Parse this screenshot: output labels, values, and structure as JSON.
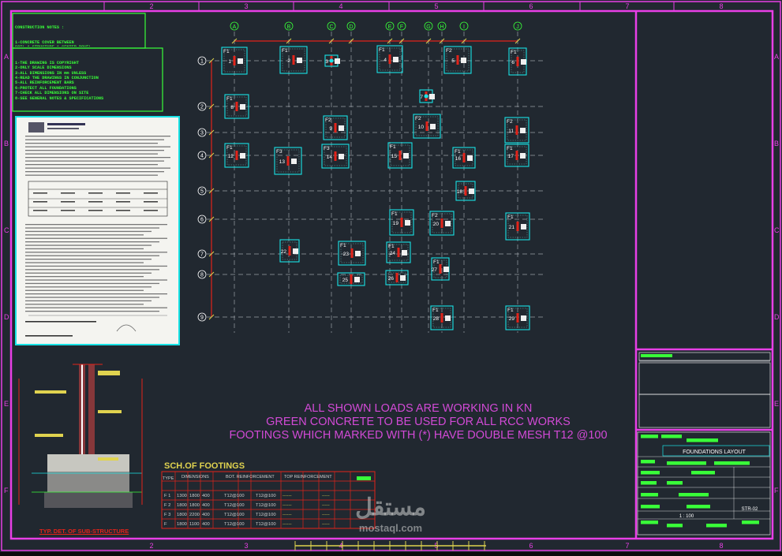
{
  "grid_columns": [
    "A",
    "B",
    "C",
    "D",
    "E",
    "F",
    "G",
    "H",
    "I",
    "J"
  ],
  "grid_rows": [
    "1",
    "2",
    "3",
    "4",
    "5",
    "6",
    "7",
    "8",
    "9"
  ],
  "border_ticks_top": [
    "2",
    "3",
    "4",
    "5",
    "6",
    "7",
    "8"
  ],
  "border_ticks_side": [
    "A",
    "B",
    "C",
    "D",
    "E",
    "F"
  ],
  "footing_tags": [
    "1",
    "2",
    "3",
    "4",
    "5",
    "6",
    "7",
    "8",
    "9",
    "10",
    "11",
    "12",
    "13",
    "14",
    "15",
    "16",
    "17",
    "18",
    "19",
    "20",
    "21",
    "22",
    "23",
    "24",
    "25",
    "26",
    "27",
    "28",
    "29"
  ],
  "footing_types": [
    "F1",
    "F2",
    "F3"
  ],
  "notes": {
    "title": "CONSTRUCTION NOTES :",
    "lines_a": [
      "1-CONCRETE COVER BETWEEN",
      "SOIL & STRUCTURE & CENTER DOWEL",
      "2-COMPACTED FILL FOUNDATION",
      "3-DESIGN WORK TO BE APPROVED",
      "4-REFER TO SOIL REPORT"
    ],
    "lines_b": [
      "1-THE DRAWING IS COPYRIGHT",
      "2-ONLY SCALE DIMENSIONS",
      "3-ALL DIMENSIONS IN mm UNLESS",
      "4-READ THE DRAWINGS IN CONJUNCTION",
      "5-ALL REINFORCEMENT BARS",
      "6-PROTECT ALL FOUNDATIONS",
      "7-CHECK ALL DIMENSIONS ON SITE",
      "8-SEE GENERAL NOTES & SPECIFICATIONS"
    ]
  },
  "load_notes": [
    "ALL SHOWN LOADS ARE WORKING IN KN",
    "GREEN CONCRETE TO BE USED FOR ALL RCC WORKS",
    "FOOTINGS WHICH MARKED WITH (*) HAVE DOUBLE MESH T12 @100"
  ],
  "schedule": {
    "title": "SCH.OF FOOTINGS",
    "headers": [
      "TYPE",
      "DIMENSIONS",
      "BOT. REINFORCEMENT",
      "TOP REINFORCEMENT"
    ],
    "rows": [
      [
        "F 1",
        "1300",
        "1800",
        "400",
        "T12@100",
        "T12@100"
      ],
      [
        "F 2",
        "1800",
        "1800",
        "400",
        "T12@100",
        "T12@100"
      ],
      [
        "F 3",
        "1800",
        "2200",
        "400",
        "T12@100",
        "T12@100"
      ],
      [
        "F",
        "1800",
        "1100",
        "400",
        "T12@100",
        "T12@100"
      ]
    ]
  },
  "section": {
    "title": "TYP. DET. OF SUB-STRUCTURE"
  },
  "title_block": {
    "drawing_title": "FOUNDATIONS LAYOUT",
    "scale": "1 : 100",
    "drawing_no": "STR-02"
  },
  "watermark": {
    "arabic": "مستقل",
    "latin": "mostaql.com"
  },
  "colors": {
    "frame": "#e83fe6",
    "grid": "#9aa0a6",
    "footing": "#19e3e6",
    "column": "#e2231a",
    "green_text": "#39ff39",
    "load_text": "#d24ad6"
  }
}
